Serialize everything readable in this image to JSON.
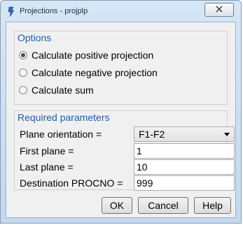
{
  "window": {
    "title": "Projections - projplp",
    "close_label": "X"
  },
  "options": {
    "title": "Options",
    "radios": [
      {
        "label": "Calculate positive projection",
        "selected": true
      },
      {
        "label": "Calculate negative projection",
        "selected": false
      },
      {
        "label": "Calculate sum",
        "selected": false
      }
    ]
  },
  "params": {
    "title": "Required parameters",
    "plane_orientation_label": "Plane orientation =",
    "plane_orientation_value": "F1-F2",
    "first_plane_label": "First plane =",
    "first_plane_value": "1",
    "last_plane_label": "Last plane =",
    "last_plane_value": "10",
    "dest_procno_label": "Destination PROCNO =",
    "dest_procno_value": "999"
  },
  "buttons": {
    "ok": "OK",
    "cancel": "Cancel",
    "help": "Help"
  },
  "colors": {
    "group_title": "#1f5dab",
    "title_bar": "#c4d8ef"
  },
  "icons": {
    "app": "topspin-app-icon",
    "close": "close-icon"
  }
}
